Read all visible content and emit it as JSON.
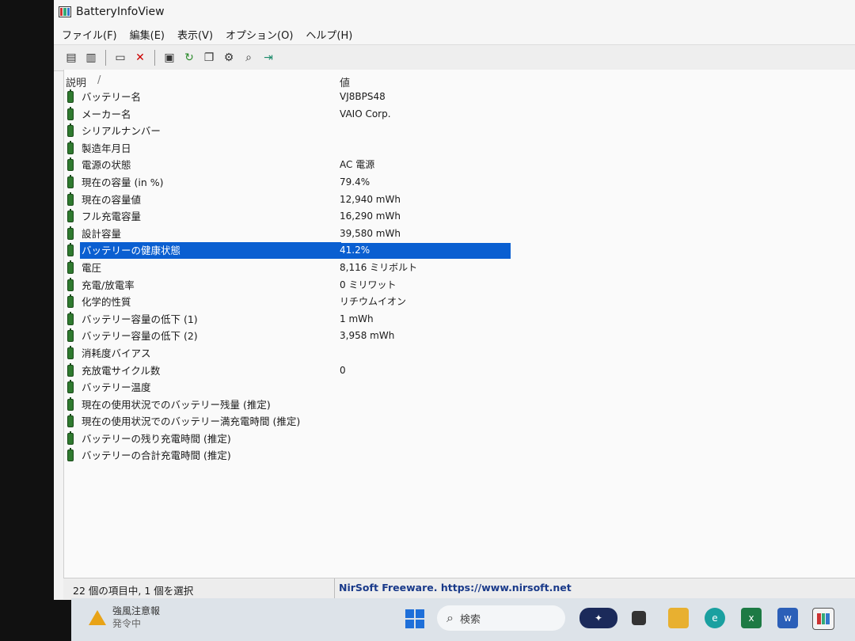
{
  "window": {
    "title": "BatteryInfoView"
  },
  "menu": [
    "ファイル(F)",
    "編集(E)",
    "表示(V)",
    "オプション(O)",
    "ヘルプ(H)"
  ],
  "toolbar": {
    "icons": [
      "html-report-icon",
      "text-view-icon",
      "properties-icon",
      "delete-icon",
      "save-icon",
      "refresh-icon",
      "copy-icon",
      "options-icon",
      "find-icon",
      "exit-icon"
    ]
  },
  "columns": {
    "desc": "説明",
    "sort_mark": "/",
    "value": "値"
  },
  "rows": [
    {
      "desc": "バッテリー名",
      "value": "VJ8BPS48"
    },
    {
      "desc": "メーカー名",
      "value": "VAIO Corp."
    },
    {
      "desc": "シリアルナンバー",
      "value": ""
    },
    {
      "desc": "製造年月日",
      "value": ""
    },
    {
      "desc": "電源の状態",
      "value": "AC 電源"
    },
    {
      "desc": "現在の容量 (in %)",
      "value": "79.4%"
    },
    {
      "desc": "現在の容量値",
      "value": "12,940 mWh"
    },
    {
      "desc": "フル充電容量",
      "value": "16,290 mWh"
    },
    {
      "desc": "設計容量",
      "value": "39,580 mWh"
    },
    {
      "desc": "バッテリーの健康状態",
      "value": "41.2%",
      "selected": true
    },
    {
      "desc": "電圧",
      "value": "8,116 ミリボルト"
    },
    {
      "desc": "充電/放電率",
      "value": "0 ミリワット"
    },
    {
      "desc": "化学的性質",
      "value": "リチウムイオン"
    },
    {
      "desc": "バッテリー容量の低下 (1)",
      "value": "1 mWh"
    },
    {
      "desc": "バッテリー容量の低下 (2)",
      "value": "3,958 mWh"
    },
    {
      "desc": "消耗度バイアス",
      "value": ""
    },
    {
      "desc": "充放電サイクル数",
      "value": "0"
    },
    {
      "desc": "バッテリー温度",
      "value": ""
    },
    {
      "desc": "現在の使用状況でのバッテリー残量 (推定)",
      "value": ""
    },
    {
      "desc": "現在の使用状況でのバッテリー満充電時間 (推定)",
      "value": ""
    },
    {
      "desc": "バッテリーの残り充電時間 (推定)",
      "value": ""
    },
    {
      "desc": "バッテリーの合計充電時間 (推定)",
      "value": ""
    }
  ],
  "status": {
    "left": "22 個の項目中, 1 個を選択",
    "right": "NirSoft Freeware. https://www.nirsoft.net"
  },
  "taskbar": {
    "weather_line1": "強風注意報",
    "weather_line2": "発令中",
    "search_placeholder": "検索"
  },
  "colors": {
    "selection": "#0a5fd1",
    "battery": "#2f7a2f",
    "start": "#1e6fd9"
  }
}
